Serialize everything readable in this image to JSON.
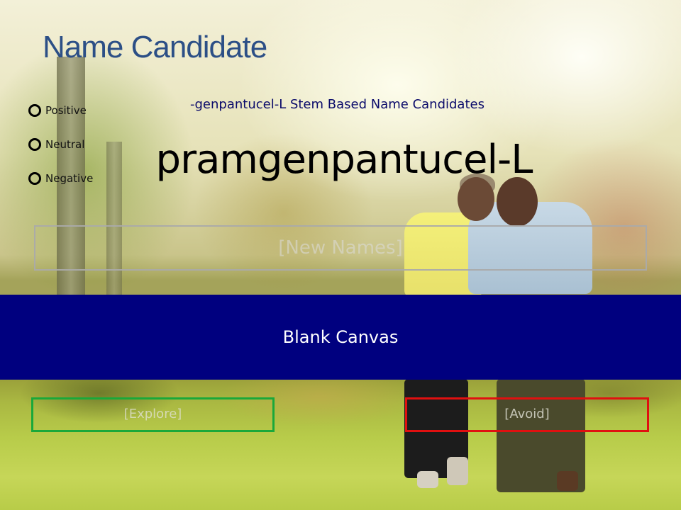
{
  "slide": {
    "title": "Name Candidate",
    "subtitle": "-genpantucel-L Stem Based Name Candidates",
    "candidate_name": "pramgenpantucel-L"
  },
  "sentiment_options": [
    {
      "label": "Positive"
    },
    {
      "label": "Neutral"
    },
    {
      "label": "Negative"
    }
  ],
  "new_names_placeholder": "[New Names]",
  "canvas_label": "Blank Canvas",
  "explore_label": "[Explore]",
  "avoid_label": "[Avoid]",
  "colors": {
    "title": "#2c4f86",
    "subtitle": "#0a0a6a",
    "canvas_band": "#00007f",
    "explore_border": "#1aa83a",
    "avoid_border": "#e01010"
  },
  "background_image": "photo-of-couple-walking-in-park"
}
